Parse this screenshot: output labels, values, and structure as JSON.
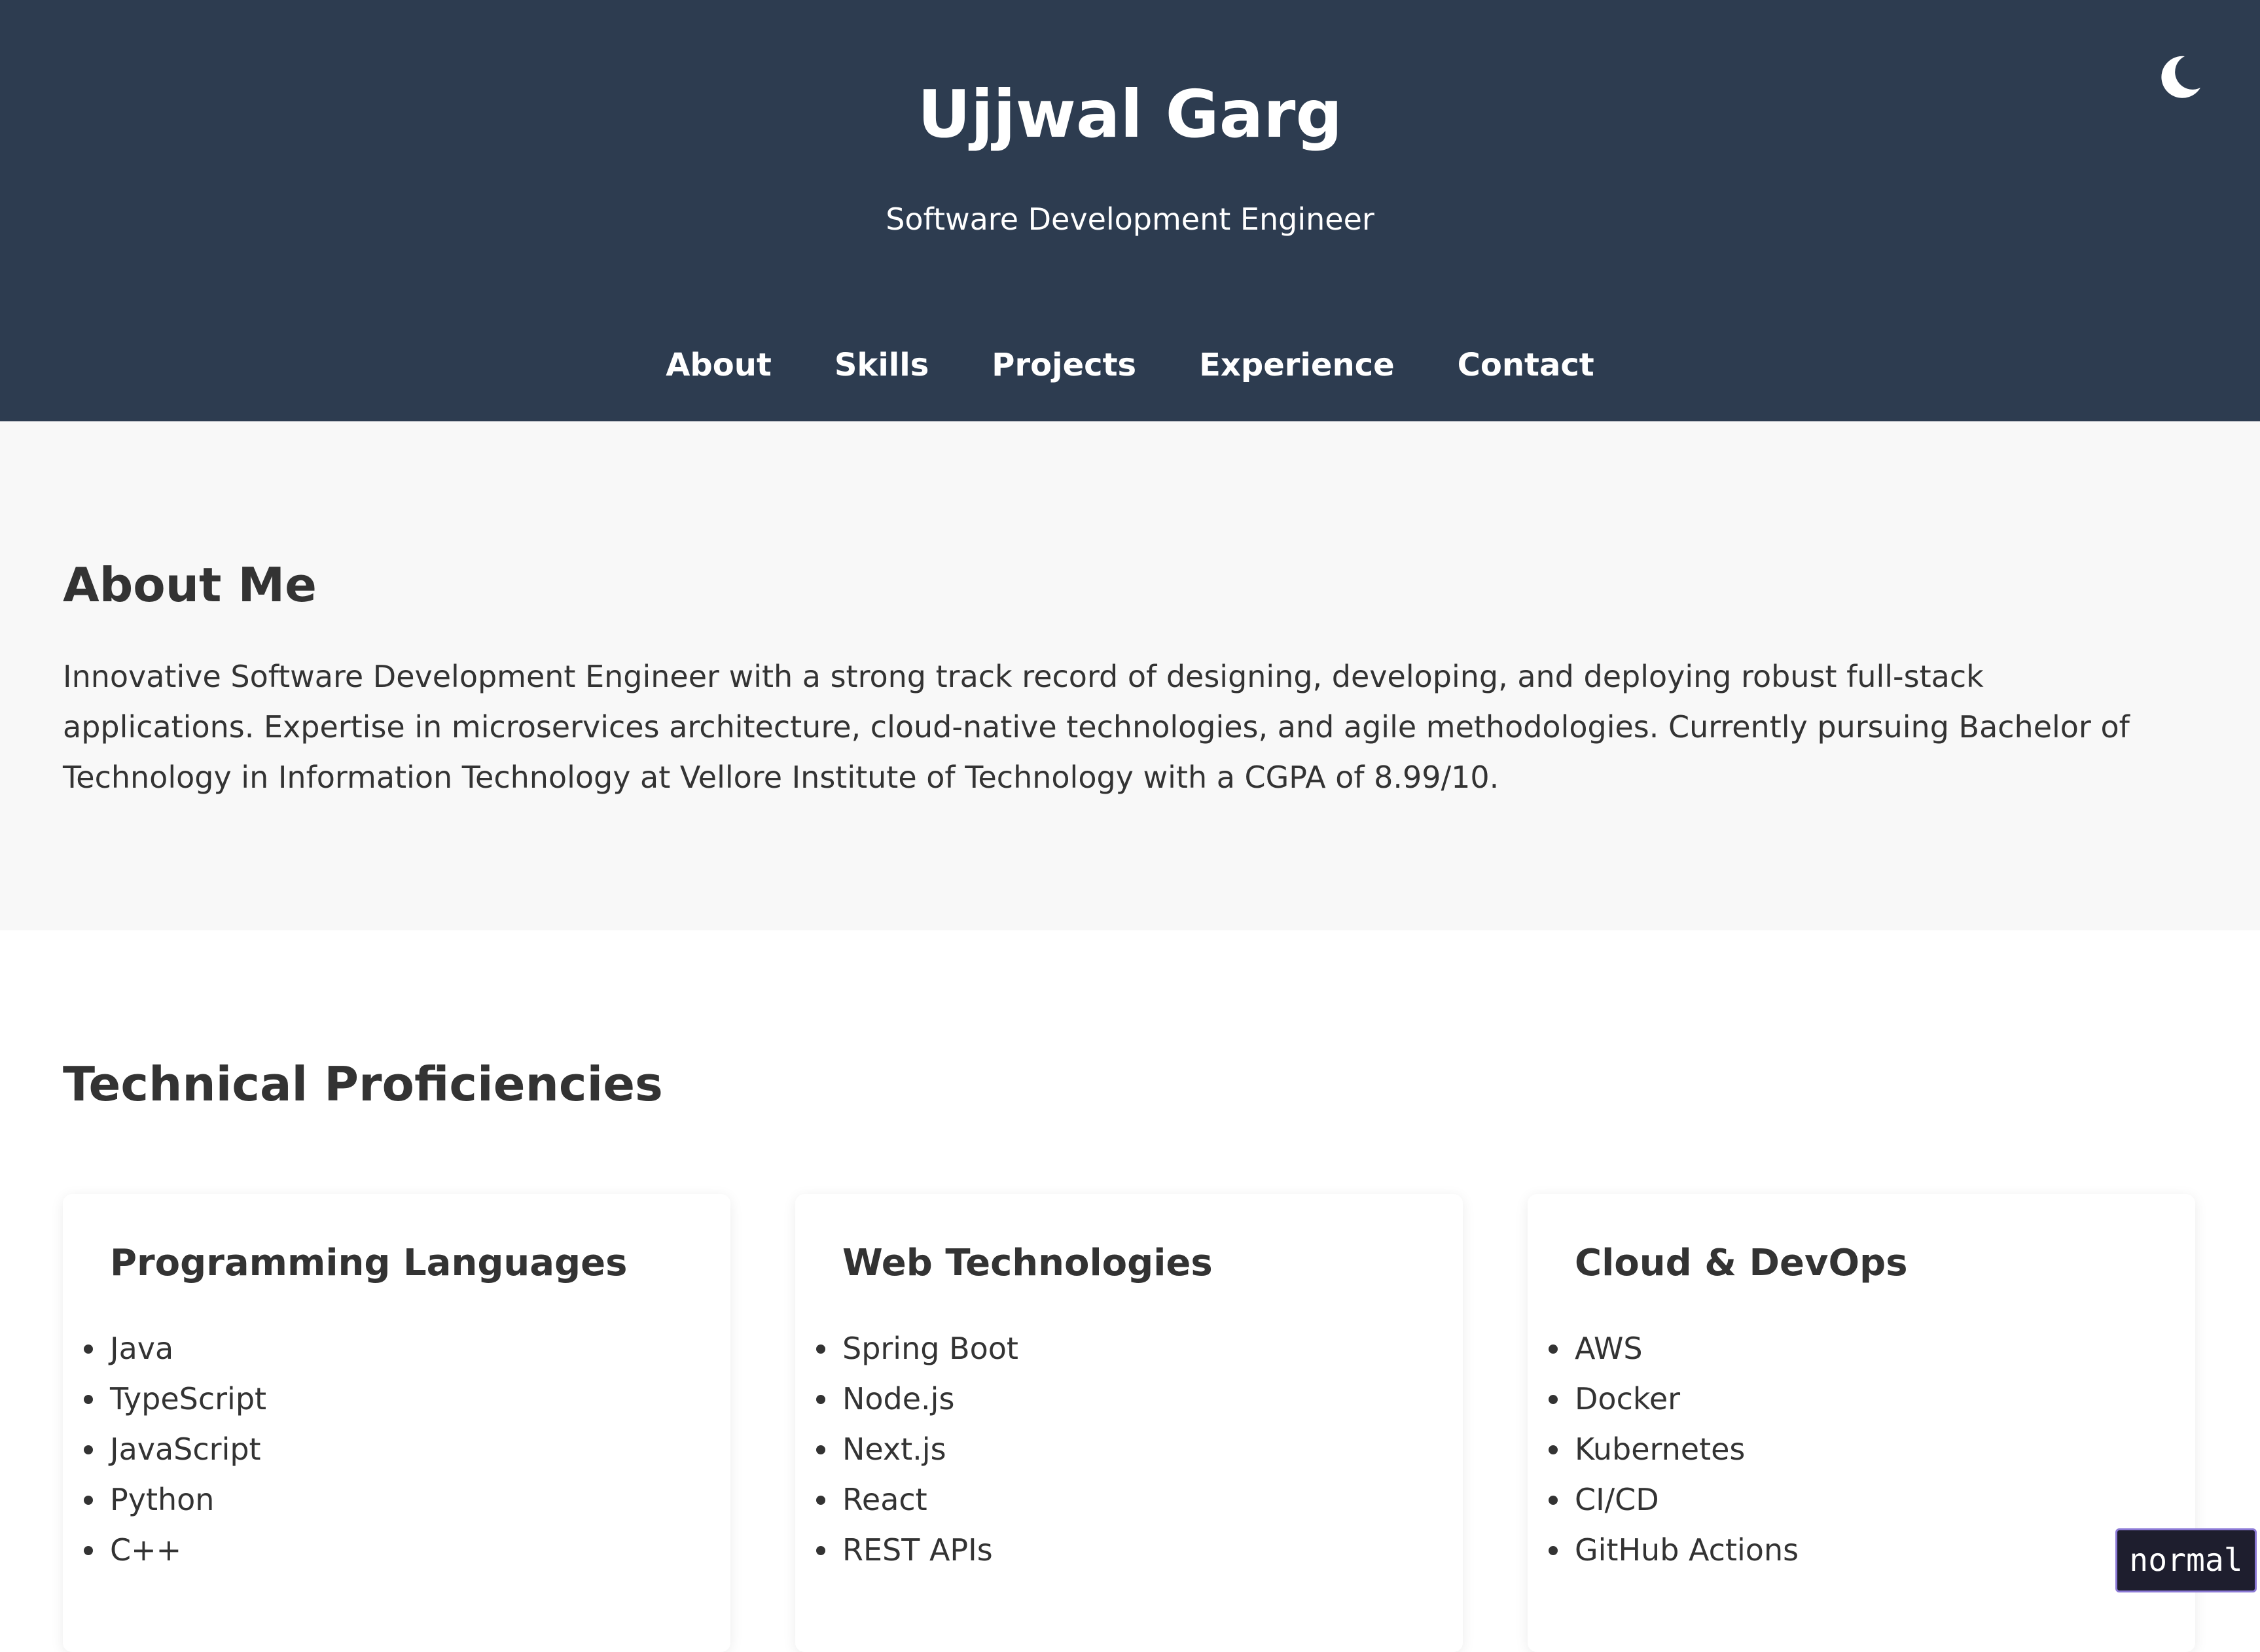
{
  "header": {
    "name": "Ujjwal Garg",
    "tagline": "Software Development Engineer",
    "theme_toggle_icon": "moon-icon",
    "background_color": "#2d3c50"
  },
  "nav": {
    "items": [
      {
        "label": "About"
      },
      {
        "label": "Skills"
      },
      {
        "label": "Projects"
      },
      {
        "label": "Experience"
      },
      {
        "label": "Contact"
      }
    ]
  },
  "about": {
    "heading": "About Me",
    "text": "Innovative Software Development Engineer with a strong track record of designing, developing, and deploying robust full-stack applications. Expertise in microservices architecture, cloud-native technologies, and agile methodologies. Currently pursuing Bachelor of Technology in Information Technology at Vellore Institute of Technology with a CGPA of 8.99/10."
  },
  "skills": {
    "heading": "Technical Proficiencies",
    "cards": [
      {
        "title": "Programming Languages",
        "items": [
          "Java",
          "TypeScript",
          "JavaScript",
          "Python",
          "C++"
        ]
      },
      {
        "title": "Web Technologies",
        "items": [
          "Spring Boot",
          "Node.js",
          "Next.js",
          "React",
          "REST APIs"
        ]
      },
      {
        "title": "Cloud & DevOps",
        "items": [
          "AWS",
          "Docker",
          "Kubernetes",
          "CI/CD",
          "GitHub Actions"
        ]
      }
    ]
  },
  "mode_indicator": {
    "label": "normal"
  }
}
